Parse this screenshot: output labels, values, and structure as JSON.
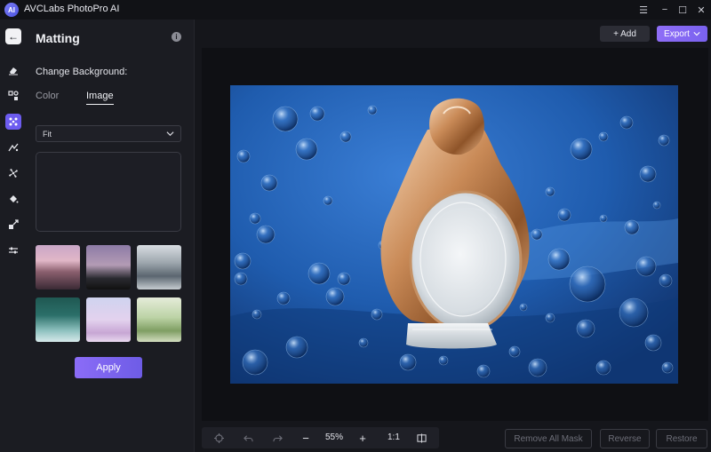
{
  "app": {
    "title": "AVCLabs PhotoPro AI",
    "logo_text": "AI"
  },
  "window_controls": {
    "menu": "☰",
    "minimize": "−",
    "maximize": "☐",
    "close": "✕"
  },
  "rail": {
    "back_glyph": "←"
  },
  "panel": {
    "title": "Matting",
    "info_glyph": "i",
    "section_label": "Change Background:",
    "tabs": [
      {
        "label": "Color"
      },
      {
        "label": "Image"
      }
    ],
    "active_tab": "Image",
    "fit_select": {
      "value": "Fit"
    },
    "apply_label": "Apply"
  },
  "toolbar": {
    "add_label": "+ Add",
    "export_label": "Export"
  },
  "bottom": {
    "zoom": "55%",
    "minus": "−",
    "plus": "+",
    "ratio": "1:1",
    "remove_all_mask": "Remove All Mask",
    "reverse": "Reverse",
    "restore": "Restore"
  },
  "colors": {
    "accent": "#7a62ef",
    "canvas_bg": "#0f1014",
    "panel_bg": "#1b1c22"
  }
}
